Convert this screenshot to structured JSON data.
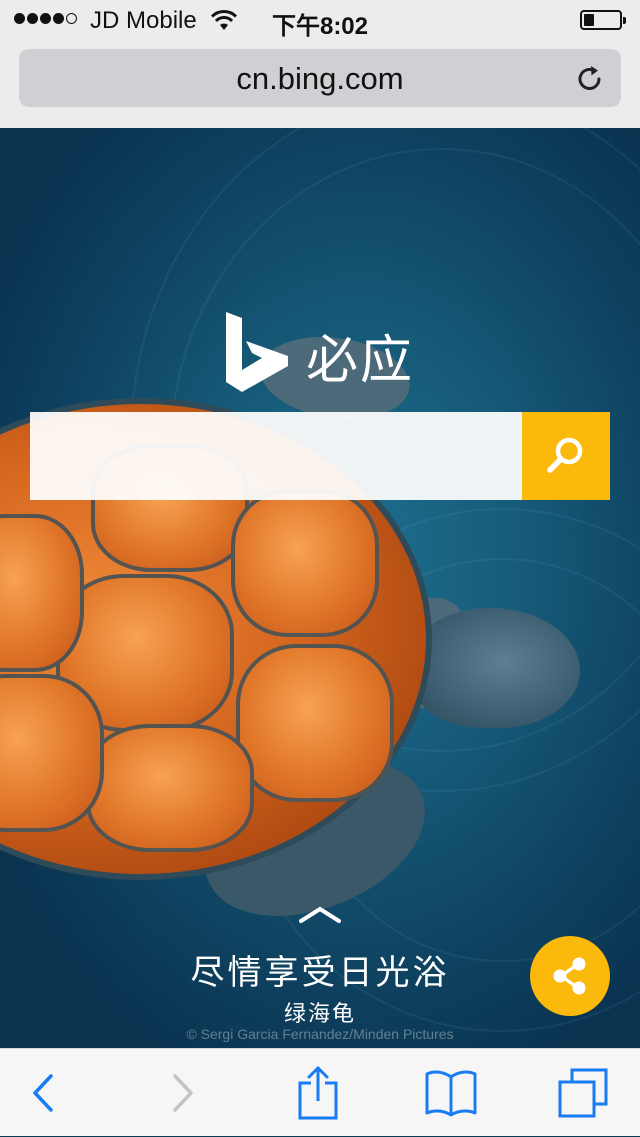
{
  "status_bar": {
    "signal_bars_filled": 4,
    "signal_bars_total": 5,
    "carrier": "JD Mobile",
    "time": "下午8:02",
    "battery_level": 0.3
  },
  "browser": {
    "url": "cn.bing.com",
    "reload_icon": "reload-icon"
  },
  "page": {
    "brand_name": "必应",
    "search_placeholder": "",
    "search_icon": "search-icon",
    "caption_title": "尽情享受日光浴",
    "caption_subtitle": "绿海龟",
    "photo_credit": "© Sergi Garcia Fernandez/Minden Pictures",
    "share_icon": "share-icon",
    "accent_color": "#fbb90c"
  },
  "toolbar": {
    "icons": [
      "back-icon",
      "forward-icon",
      "share-up-icon",
      "bookmarks-icon",
      "tabs-icon"
    ],
    "tint_color": "#1a7cf3",
    "disabled_color": "#c4c4c8"
  }
}
